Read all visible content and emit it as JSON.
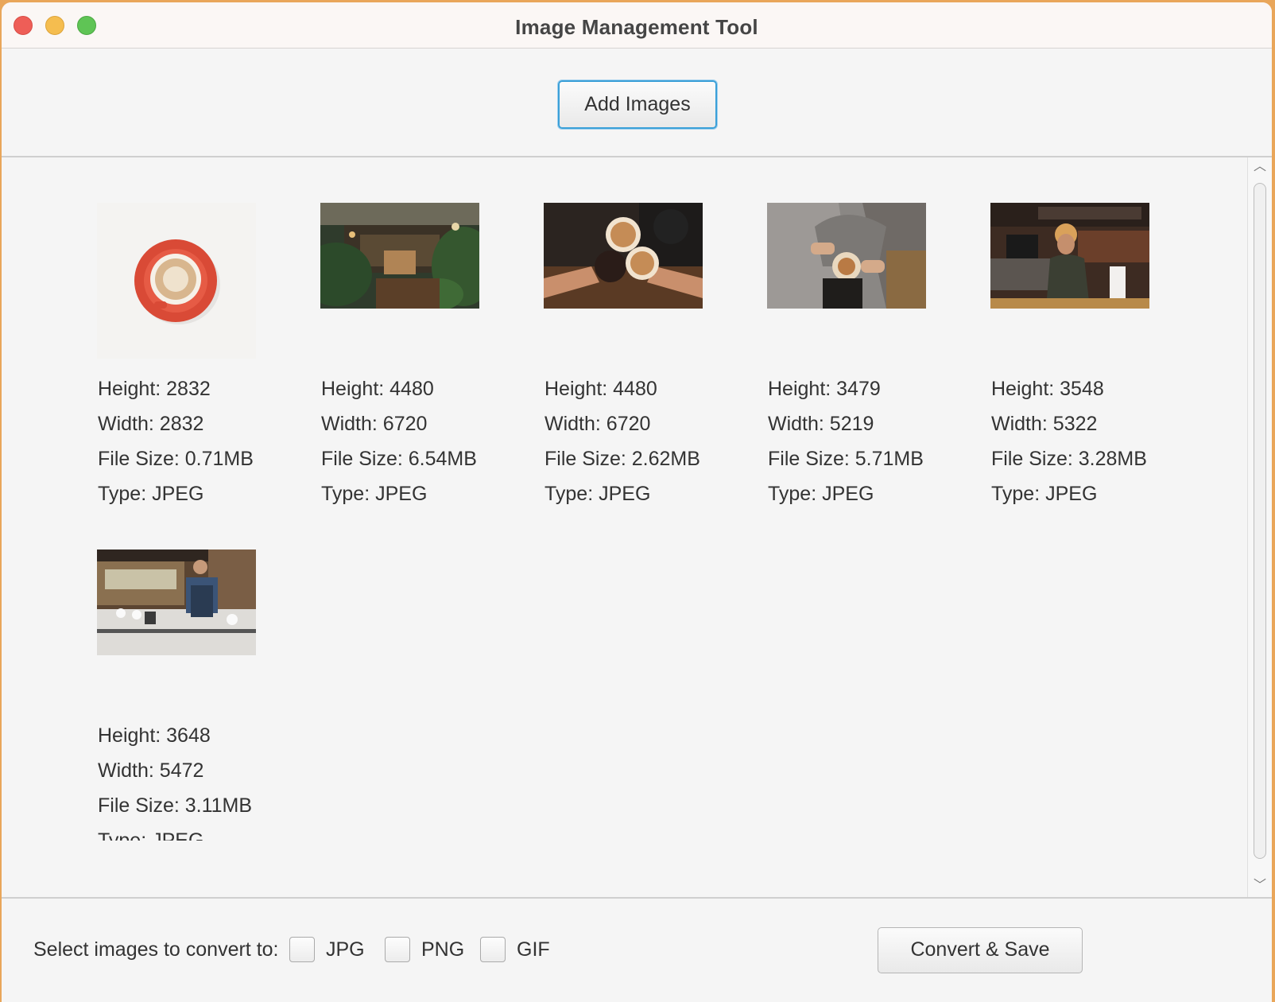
{
  "window": {
    "title": "Image Management Tool"
  },
  "toolbar": {
    "add_images_label": "Add Images"
  },
  "images": [
    {
      "height": "Height: 2832",
      "width": "Width: 2832",
      "size": "File Size: 0.71MB",
      "type": "Type: JPEG",
      "thumb": "coffee-cup-top-view"
    },
    {
      "height": "Height: 4480",
      "width": "Width: 6720",
      "size": "File Size: 6.54MB",
      "type": "Type: JPEG",
      "thumb": "cafe-interior-plants"
    },
    {
      "height": "Height: 4480",
      "width": "Width: 6720",
      "size": "File Size: 2.62MB",
      "type": "Type: JPEG",
      "thumb": "latte-cheers"
    },
    {
      "height": "Height: 3479",
      "width": "Width: 5219",
      "size": "File Size: 5.71MB",
      "type": "Type: JPEG",
      "thumb": "latte-art-pour"
    },
    {
      "height": "Height: 3548",
      "width": "Width: 5322",
      "size": "File Size: 3.28MB",
      "type": "Type: JPEG",
      "thumb": "barista-counter"
    },
    {
      "height": "Height: 3648",
      "width": "Width: 5472",
      "size": "File Size: 3.11MB",
      "type": "Type: JPEG",
      "thumb": "barista-pour-over"
    }
  ],
  "bottom": {
    "prompt": "Select images to convert to:",
    "formats": [
      "JPG",
      "PNG",
      "GIF"
    ],
    "convert_label": "Convert & Save"
  },
  "colors": {
    "focus_ring": "#3ba0d8",
    "close": "#ee5e57",
    "minimize": "#f5bd4f",
    "maximize": "#5fc455"
  }
}
